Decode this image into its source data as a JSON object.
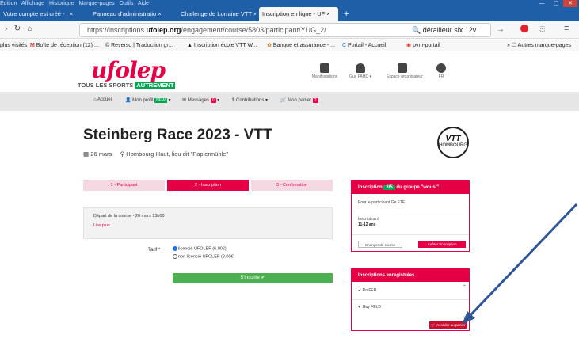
{
  "browser": {
    "menu": [
      "Édition",
      "Affichage",
      "Historique",
      "Marque-pages",
      "Outils",
      "Aide"
    ],
    "tabs": [
      {
        "label": "Votre compte est créé - ."
      },
      {
        "label": "Panneau d'administratio"
      },
      {
        "label": "Challenge de Lorraine VTT"
      },
      {
        "label": "Inscription en ligne - UF",
        "active": true
      }
    ],
    "url_prefix": "https://inscriptions.",
    "url_domain": "ufolep.org",
    "url_path": "/engagement/course/5803/participant/YUG_2/",
    "search_query": "dérailleur slx 12v",
    "bookmarks": [
      "plus visités",
      "Boîte de réception (12) ...",
      "Reverso | Traduction gr...",
      "Inscription école VTT W...",
      "Banque et assurance - ...",
      "Portail - Accueil",
      "pvm-portail",
      "Autres marque-pages"
    ]
  },
  "site": {
    "logo": "ufolep",
    "tagline_a": "TOUS LES SPORTS",
    "tagline_b": "AUTREMENT",
    "header_icons": [
      {
        "label": "Manifestations",
        "icon": "calendar-icon"
      },
      {
        "label": "Guy FAHD ▾",
        "icon": "user-icon"
      },
      {
        "label": "Espace organisateur",
        "icon": "lock-icon"
      },
      {
        "label": "FR",
        "icon": "globe-icon"
      }
    ],
    "nav": [
      {
        "label": "Accueil"
      },
      {
        "label": "Mon profil",
        "badge": "NEW"
      },
      {
        "label": "Messages",
        "badge": "0"
      },
      {
        "label": "Contributions ▾"
      },
      {
        "label": "Mon panier",
        "badge": "2"
      }
    ]
  },
  "event": {
    "title": "Steinberg Race 2023 - VTT",
    "date": "26 mars",
    "location": "Hombourg-Haut, lieu dit \"Papiermühle\"",
    "logo_text": "VTT",
    "logo_sub": "HOMBOURG"
  },
  "steps": [
    "1 - Participant",
    "2 - Inscription",
    "3 - Confirmation"
  ],
  "form": {
    "depart": "Départ de la course - 26 mars 13h00",
    "lire_plus": "Lire plus",
    "tarif_label": "Tarif *",
    "options": [
      "licencié UFOLEP (6.00€)",
      "non licencié UFOLEP (8.00€)"
    ],
    "submit": "S'inscrire ✔"
  },
  "panel_inscription": {
    "title_a": "Inscription",
    "title_n": "3/5",
    "title_b": "du groupe \"wousi\"",
    "participant": "Pour le participant Ge FTE",
    "cat_label": "Inscription à",
    "cat_value": "11-12 ans",
    "btn_change": "Changer de course",
    "btn_stop": "Arrêter l'inscription"
  },
  "panel_registered": {
    "title": "Inscriptions enregistrées",
    "items": [
      "Ro FER",
      "Guy FELD"
    ],
    "btn_cart": "Accéder au panier"
  }
}
